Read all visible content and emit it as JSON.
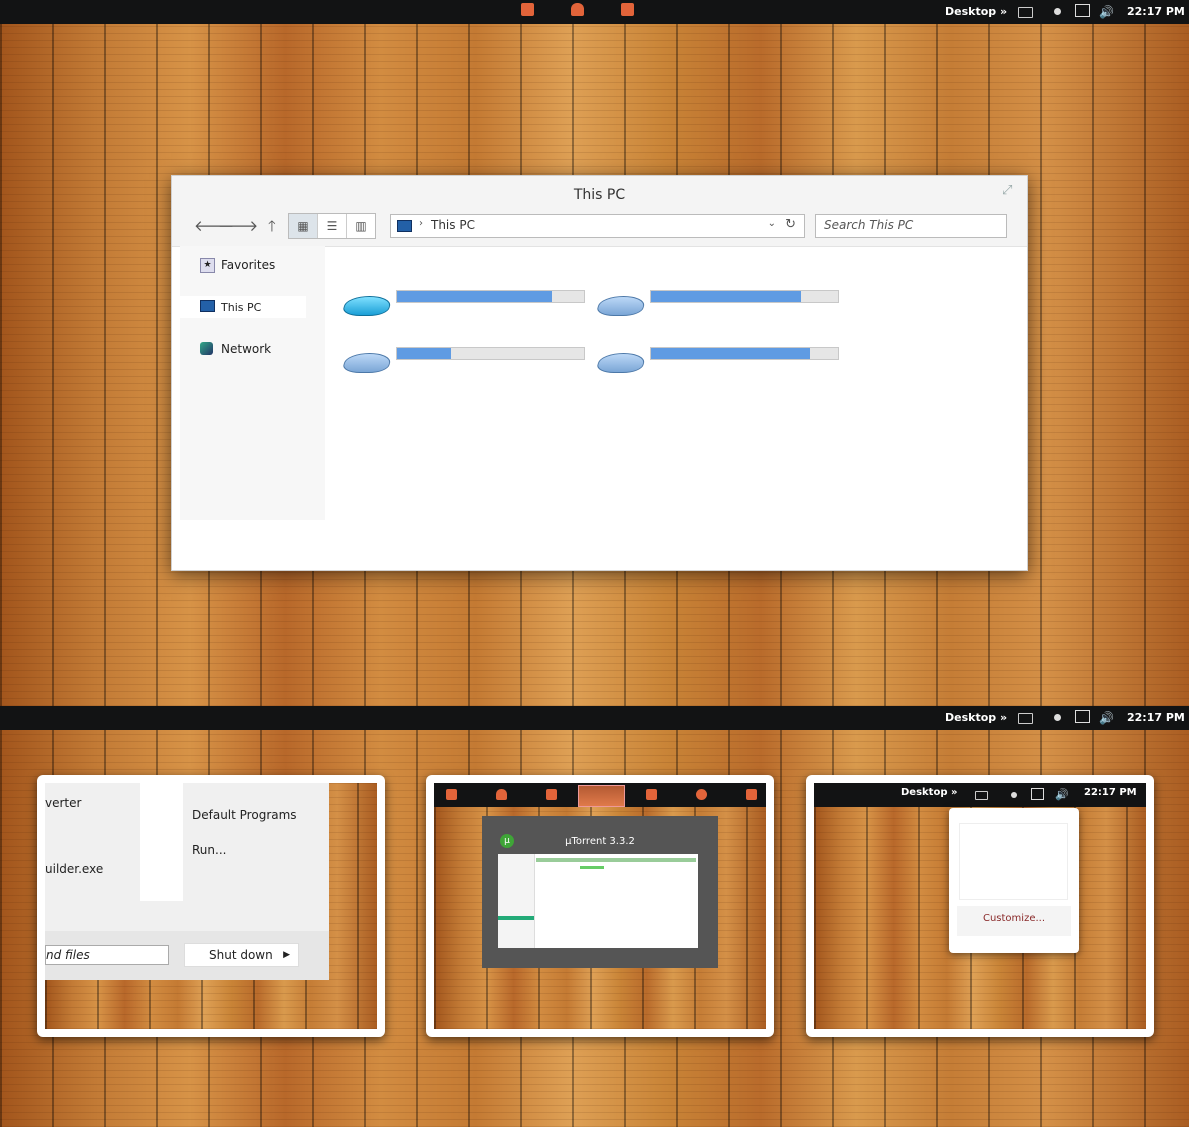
{
  "taskbar": {
    "desktop_label": "Desktop »",
    "clock": "22:17 PM",
    "pinned_icons": [
      "app-icon",
      "cloud-icon",
      "document-icon"
    ]
  },
  "explorer": {
    "title": "This PC",
    "address_location": "This PC",
    "search_placeholder": "Search This PC",
    "nav_items": [
      {
        "label": "Favorites",
        "icon": "star-icon"
      },
      {
        "label": "This PC",
        "icon": "computer-icon"
      },
      {
        "label": "Network",
        "icon": "network-icon"
      }
    ],
    "drives": [
      {
        "type": "system",
        "used_fraction": 0.83
      },
      {
        "type": "disk",
        "used_fraction": 0.8
      },
      {
        "type": "disk",
        "used_fraction": 0.29
      },
      {
        "type": "disk",
        "used_fraction": 0.85
      }
    ]
  },
  "start_menu_thumb": {
    "left_items": [
      "verter",
      "uilder.exe"
    ],
    "right_items": [
      "Default Programs",
      "Run..."
    ],
    "search_text": "nd files",
    "shutdown_label": "Shut down"
  },
  "utorrent_thumb": {
    "window_title": "µTorrent 3.3.2",
    "logo_letter": "µ"
  },
  "tray_thumb": {
    "desktop_label": "Desktop »",
    "clock": "22:17 PM",
    "customize_label": "Customize..."
  }
}
